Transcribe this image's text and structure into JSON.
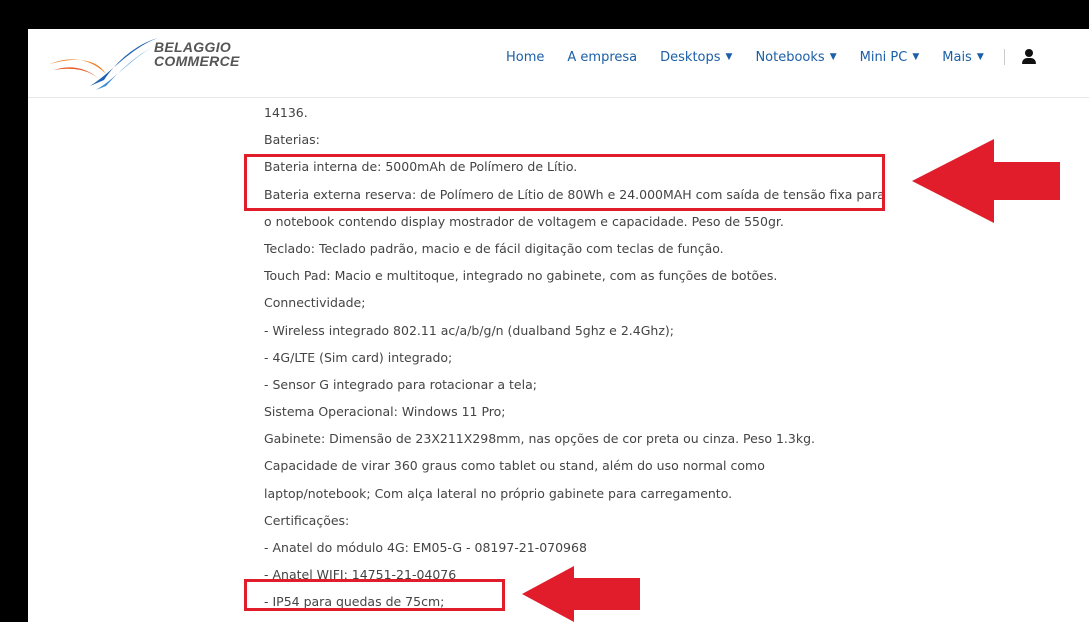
{
  "logo": {
    "line1": "BELAGGIO",
    "line2": "COMMERCE"
  },
  "nav": {
    "items": [
      {
        "label": "Home",
        "dropdown": false
      },
      {
        "label": "A empresa",
        "dropdown": false
      },
      {
        "label": "Desktops",
        "dropdown": true
      },
      {
        "label": "Notebooks",
        "dropdown": true
      },
      {
        "label": "Mini PC",
        "dropdown": true
      },
      {
        "label": "Mais",
        "dropdown": true
      }
    ],
    "caret": "▼",
    "user_icon": "user-icon"
  },
  "content": {
    "lines": [
      "14136.",
      "Baterias:",
      "Bateria interna de: 5000mAh de Polímero de Lítio.",
      "Bateria externa reserva: de Polímero de Lítio de 80Wh e 24.000MAH com saída de tensão fixa para",
      "o notebook contendo display mostrador de voltagem e capacidade. Peso  de 550gr.",
      "Teclado: Teclado padrão, macio e de fácil digitação com teclas de função.",
      "Touch Pad:  Macio e multitoque,  integrado no gabinete, com as funções de botões.",
      "Connectividade;",
      "- Wireless integrado 802.11 ac/a/b/g/n (dualband 5ghz e 2.4Ghz);",
      "- 4G/LTE (Sim card) integrado;",
      "- Sensor G integrado para rotacionar a tela;",
      "Sistema Operacional:  Windows 11 Pro;",
      "Gabinete: Dimensão de 23X211X298mm, nas opções de cor preta ou cinza. Peso 1.3kg.",
      " Capacidade de virar 360 graus como tablet ou stand, além do uso normal como",
      "laptop/notebook; Com alça lateral no próprio gabinete para carregamento.",
      "Certificações:",
      "- Anatel do módulo 4G: EM05-G - 08197-21-070968",
      "- Anatel WIFI: 14751-21-04076",
      "- IP54 para quedas de 75cm;"
    ]
  },
  "annotation_color": "#e21d2b"
}
